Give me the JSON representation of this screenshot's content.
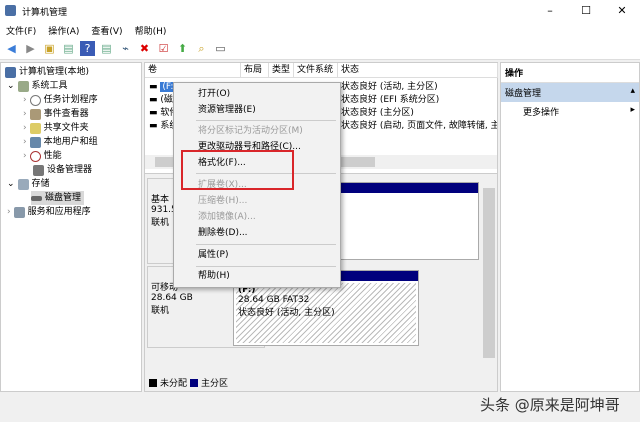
{
  "window": {
    "title": "计算机管理",
    "min": "–",
    "max": "☐",
    "close": "✕"
  },
  "menubar": [
    "文件(F)",
    "操作(A)",
    "查看(V)",
    "帮助(H)"
  ],
  "tree": {
    "root": "计算机管理(本地)",
    "system_tools": "系统工具",
    "items": [
      "任务计划程序",
      "事件查看器",
      "共享文件夹",
      "本地用户和组",
      "性能",
      "设备管理器"
    ],
    "storage": "存储",
    "disk_mgmt": "磁盘管理",
    "services": "服务和应用程序"
  },
  "volumes": {
    "headers": [
      "卷",
      "布局",
      "类型",
      "文件系统",
      "状态"
    ],
    "rows": [
      {
        "name": "(F:)",
        "status": "状态良好 (活动, 主分区)"
      },
      {
        "name": "(磁",
        "status": "状态良好 (EFI 系统分区)"
      },
      {
        "name": "软件",
        "status": "状态良好 (主分区)"
      },
      {
        "name": "系统",
        "status": "状态良好 (启动, 页面文件, 故障转储, 主"
      }
    ]
  },
  "disks": [
    {
      "type": "基本",
      "size": "931.5",
      "state": "联机"
    },
    {
      "type": "可移动",
      "size": "28.64 GB",
      "state": "联机",
      "partition": {
        "label": "(F:)",
        "info": "28.64 GB FAT32",
        "status": "状态良好 (活动, 主分区)"
      }
    }
  ],
  "legend": [
    "未分配",
    "主分区"
  ],
  "legend_colors": [
    "#000000",
    "#00007d"
  ],
  "actions": {
    "title": "操作",
    "section": "磁盘管理",
    "more": "更多操作"
  },
  "context_menu": {
    "open": "打开(O)",
    "explorer": "资源管理器(E)",
    "mark_active": "将分区标记为活动分区(M)",
    "change_letter": "更改驱动器号和路径(C)...",
    "format": "格式化(F)...",
    "extend": "扩展卷(X)...",
    "shrink": "压缩卷(H)...",
    "mirror": "添加镜像(A)...",
    "delete": "删除卷(D)...",
    "properties": "属性(P)",
    "help": "帮助(H)"
  },
  "watermark": "头条 @原来是阿坤哥"
}
